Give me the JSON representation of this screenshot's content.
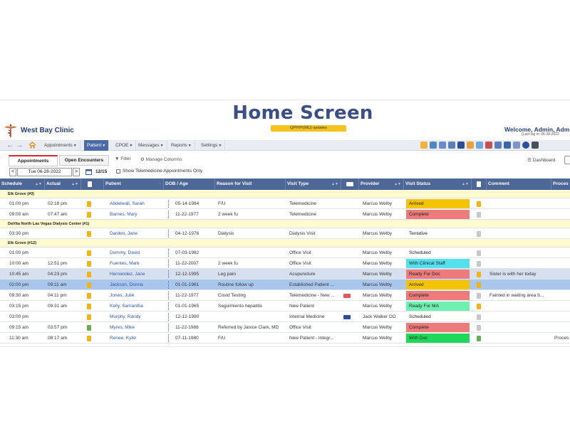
{
  "title": "Home Screen",
  "update_banner": "QPP/PI(MU) updates",
  "clinic_name": "West Bay Clinic",
  "welcome": "Welcome, Admin, Adm",
  "last_login": "(Last log in: 06-28-2022",
  "nav": {
    "back": "←",
    "forward": "→",
    "menus": [
      "Appointments",
      "Patient",
      "CPOE",
      "Messages",
      "Reports",
      "Settings"
    ],
    "active_menu": "Patient"
  },
  "tabs": {
    "appointments": "Appointments",
    "open_encounters": "Open Encounters"
  },
  "toolbar": {
    "filter": "Filter",
    "manage_columns": "Manage Columns",
    "dashboard": "Dashboard"
  },
  "date_nav": {
    "prev": "<",
    "next": ">",
    "date": "Tue 06-28-2022",
    "week": "12/15",
    "telemedicine_label": "Show Telemedicine Appointments Only"
  },
  "columns": [
    "Schedule",
    "Actual",
    "",
    "Patient",
    "DOB / Age",
    "Reason for Visit",
    "Visit Type",
    "",
    "Provider",
    "Visit Status",
    "",
    "Comment",
    "Proces"
  ],
  "rows": [
    {
      "group": "Elk Grove (#0)"
    },
    {
      "schedule": "01:00 pm",
      "actual": "02:18 pm",
      "doc": "yellow",
      "patient": "Abdelwali, Sarah",
      "dob": "05-14-1984",
      "reason": "F/U",
      "visit_type": "Telemedicine",
      "cam": "",
      "provider": "Marcus Welby",
      "status": "Arrived",
      "status_color": "#f5c400",
      "doc2": "yellow",
      "comment": "",
      "process": ""
    },
    {
      "schedule": "09:00 am",
      "actual": "07:47 am",
      "doc": "yellow",
      "patient": "Barnes, Mary",
      "dob": "11-22-1977",
      "reason": "2 week fu",
      "visit_type": "Telemedicine",
      "cam": "",
      "provider": "Marcus Welby",
      "status": "Complete",
      "status_color": "#ee7b7b",
      "doc2": "grey",
      "comment": "",
      "process": ""
    },
    {
      "group": "DaVita North Las Vegas Dialysis Center (#1)"
    },
    {
      "schedule": "03:30 pm",
      "actual": "",
      "doc": "yellow",
      "patient": "Darden, Jane",
      "dob": "04-12-1976",
      "reason": "Dialysis",
      "visit_type": "Dialysis Visit",
      "cam": "",
      "provider": "Marcus Welby",
      "status": "Tentative",
      "status_color": "",
      "doc2": "grey",
      "comment": "",
      "process": ""
    },
    {
      "group": "Elk Grove (#12)"
    },
    {
      "schedule": "01:00 pm",
      "actual": "",
      "doc": "yellow",
      "patient": "Dummy, David",
      "dob": "07-03-1982",
      "reason": "",
      "visit_type": "Office Visit",
      "cam": "",
      "provider": "Marcus Welby",
      "status": "Scheduled",
      "status_color": "",
      "doc2": "grey",
      "comment": "",
      "process": ""
    },
    {
      "schedule": "10:00 am",
      "actual": "12:51 pm",
      "doc": "yellow",
      "patient": "Fuentes, Mark",
      "dob": "11-22-2007",
      "reason": "2 week fu",
      "visit_type": "Office Visit",
      "cam": "",
      "provider": "Marcus Welby",
      "status": "With Clinical Staff",
      "status_color": "#55e0ee",
      "doc2": "grey",
      "comment": "",
      "process": ""
    },
    {
      "schedule": "10:45 am",
      "actual": "04:23 pm",
      "doc": "yellow",
      "patient": "Hernandez, Jane",
      "dob": "12-12-1995",
      "reason": "Leg pain",
      "visit_type": "Acupuncture",
      "cam": "",
      "provider": "Marcus Welby",
      "status": "Ready For Doc",
      "status_color": "#ee7b7b",
      "doc2": "yellow",
      "comment": "Sister is with her today",
      "process": "",
      "highlight": "hl-a"
    },
    {
      "schedule": "02:00 pm",
      "actual": "09:11 am",
      "doc": "yellow",
      "patient": "Jackson, Donna",
      "dob": "01-01-1981",
      "reason": "Routine follow up",
      "visit_type": "Established Patient ...",
      "cam": "",
      "provider": "Marcus Welby",
      "status": "Arrived",
      "status_color": "#f5c400",
      "doc2": "yellow",
      "comment": "",
      "process": "",
      "highlight": "hl-b"
    },
    {
      "schedule": "09:30 am",
      "actual": "04:11 pm",
      "doc": "yellow",
      "patient": "Jones, Julie",
      "dob": "11-22-1977",
      "reason": "Covid Testing",
      "visit_type": "Telemedicine - New ...",
      "cam": "red",
      "provider": "Marcus Welby",
      "status": "Complete",
      "status_color": "#ee7b7b",
      "doc2": "grey",
      "comment": "Fainted in waiting area b...",
      "process": ""
    },
    {
      "schedule": "03:15 pm",
      "actual": "09:31 am",
      "doc": "yellow",
      "patient": "Kelly, Samantha",
      "dob": "01-01-1965",
      "reason": "Seguimiento hepatitis",
      "visit_type": "New Patient",
      "cam": "",
      "provider": "Marcus Welby",
      "status": "Ready For MA",
      "status_color": "#6ef0b0",
      "doc2": "yellow",
      "comment": "",
      "process": ""
    },
    {
      "schedule": "03:00 pm",
      "actual": "",
      "doc": "yellow",
      "patient": "Murphy, Randy",
      "dob": "12-12-1990",
      "reason": "",
      "visit_type": "Internal Medicine",
      "cam": "blue",
      "provider": "Jack Walker DO",
      "status": "Scheduled",
      "status_color": "",
      "doc2": "grey",
      "comment": "",
      "process": ""
    },
    {
      "schedule": "09:15 am",
      "actual": "03:57 pm",
      "doc": "green",
      "patient": "Myres, Mike",
      "dob": "11-22-1988",
      "reason": "Referred by Janice Clark, MD",
      "visit_type": "Office Visit",
      "cam": "",
      "provider": "Marcus Welby",
      "status": "Complete",
      "status_color": "#ee7b7b",
      "doc2": "grey",
      "comment": "",
      "process": ""
    },
    {
      "schedule": "11:30 am",
      "actual": "08:17 am",
      "doc": "yellow",
      "patient": "Renee, Kylie",
      "dob": "07-11-1980",
      "reason": "F/U",
      "visit_type": "New Patient - Integr...",
      "cam": "",
      "provider": "Marcus Welby",
      "status": "With Doc",
      "status_color": "#1fd85a",
      "doc2": "green",
      "comment": "",
      "process": "Proces"
    }
  ]
}
